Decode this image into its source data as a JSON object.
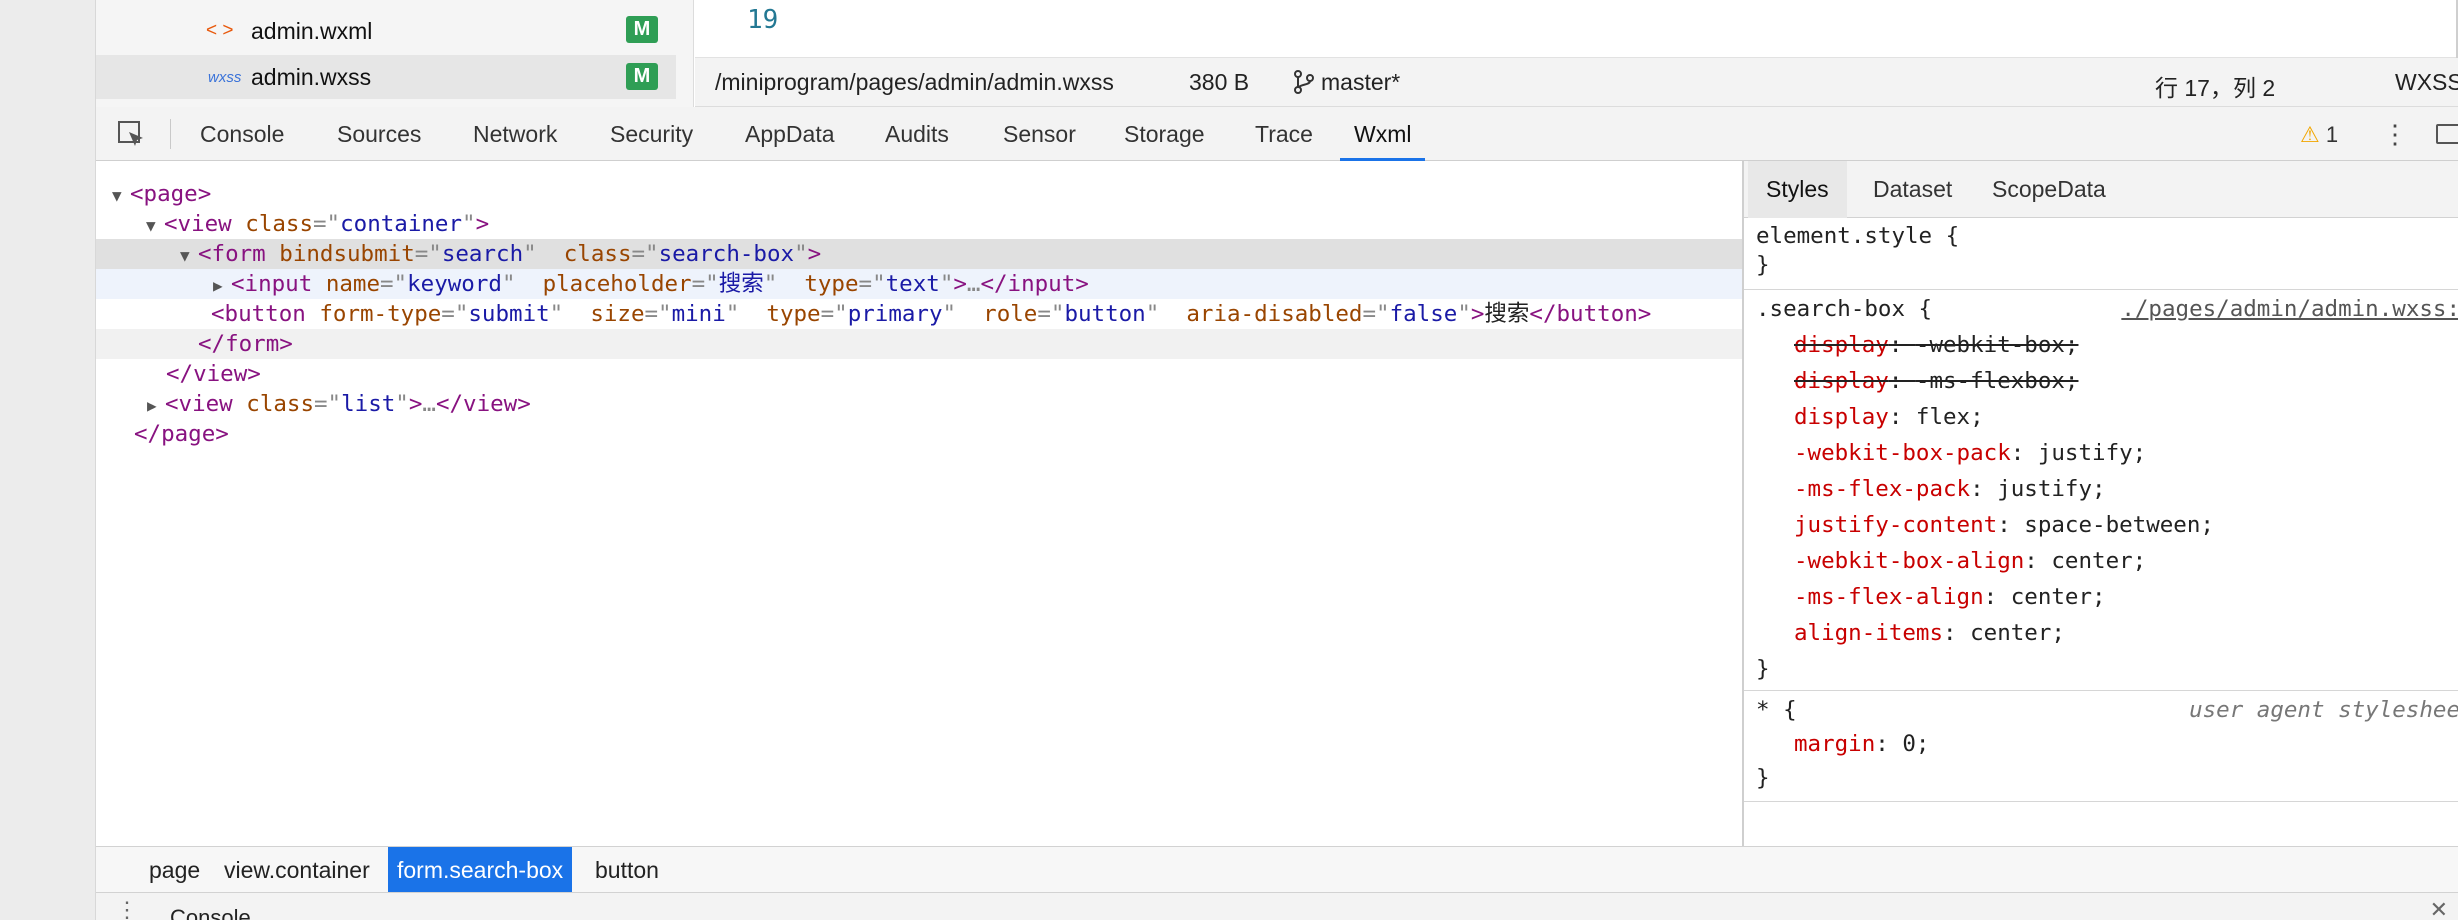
{
  "file_tree": {
    "items": [
      {
        "icon": "xml-brackets-icon",
        "icon_text": "< >",
        "name": "admin.wxml",
        "badge": "M"
      },
      {
        "icon": "wxss-file-icon",
        "icon_text": "wxss",
        "name": "admin.wxss",
        "badge": "M"
      }
    ]
  },
  "editor": {
    "line_number": "19"
  },
  "status_bar": {
    "path": "/miniprogram/pages/admin/admin.wxss",
    "size": "380 B",
    "branch": "master*",
    "cursor": "行 17，列 2",
    "language": "WXSS"
  },
  "devtools": {
    "tabs": [
      "Console",
      "Sources",
      "Network",
      "Security",
      "AppData",
      "Audits",
      "Sensor",
      "Storage",
      "Trace",
      "Wxml"
    ],
    "active_tab": "Wxml",
    "warning_count": "1",
    "accent_color": "#1a73e8"
  },
  "wxml_tree": {
    "page_open": "<page>",
    "view_tag": "<view",
    "attr_class": "class",
    "val_container": "container",
    "form_tag": "<form",
    "attr_bindsubmit": "bindsubmit",
    "val_search": "search",
    "val_search_box": "search-box",
    "input_tag": "<input",
    "attr_name": "name",
    "val_keyword": "keyword",
    "attr_placeholder": "placeholder",
    "val_placeholder": "搜索",
    "attr_type": "type",
    "val_text": "text",
    "ellipsis": "…",
    "input_close": "</input>",
    "button_tag": "<button",
    "attr_form_type": "form-type",
    "val_submit": "submit",
    "attr_size": "size",
    "val_mini": "mini",
    "val_primary": "primary",
    "attr_role": "role",
    "val_button": "button",
    "attr_aria_disabled": "aria-disabled",
    "val_false": "false",
    "button_text": "搜索",
    "button_close": "</button>",
    "form_close": "</form>",
    "view_close": "</view>",
    "val_list": "list",
    "page_close": "</page>"
  },
  "styles_pane": {
    "tabs": [
      "Styles",
      "Dataset",
      "ScopeData"
    ],
    "active_tab": "Styles",
    "element_style": "element.style {",
    "close_brace": "}",
    "search_box_selector": ".search-box {",
    "search_box_source": "./pages/admin/admin.wxss:",
    "declarations": [
      {
        "prop": "display",
        "value": "-webkit-box;",
        "overridden": true
      },
      {
        "prop": "display",
        "value": "-ms-flexbox;",
        "overridden": true
      },
      {
        "prop": "display",
        "value": "flex;",
        "overridden": false
      },
      {
        "prop": "-webkit-box-pack",
        "value": "justify;",
        "overridden": false
      },
      {
        "prop": "-ms-flex-pack",
        "value": "justify;",
        "overridden": false
      },
      {
        "prop": "justify-content",
        "value": "space-between;",
        "overridden": false
      },
      {
        "prop": "-webkit-box-align",
        "value": "center;",
        "overridden": false
      },
      {
        "prop": "-ms-flex-align",
        "value": "center;",
        "overridden": false
      },
      {
        "prop": "align-items",
        "value": "center;",
        "overridden": false
      }
    ],
    "universal_selector": "* {",
    "universal_source": "user agent styleshee",
    "universal_prop": "margin",
    "universal_value": "0;"
  },
  "breadcrumb": {
    "items": [
      "page",
      "view.container",
      "form.search-box",
      "button"
    ],
    "active": "form.search-box"
  },
  "console_drawer": {
    "label": "Console"
  }
}
